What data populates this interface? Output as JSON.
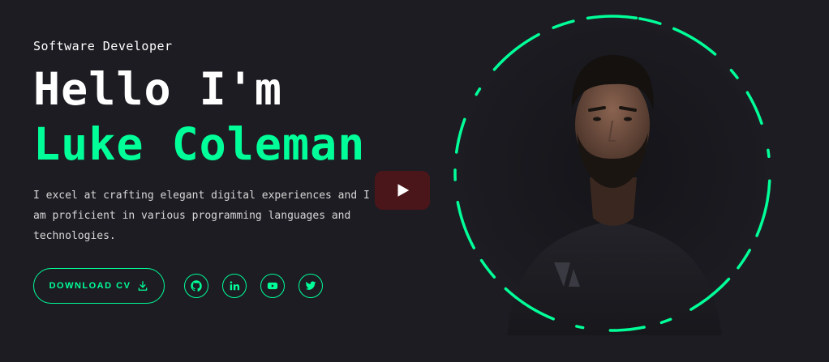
{
  "hero": {
    "role": "Software Developer",
    "title_line1": "Hello I'm",
    "title_line2": "Luke Coleman",
    "description": "I excel at crafting elegant digital experiences and I am proficient in various programming languages and technologies.",
    "download_label": "DOWNLOAD CV"
  },
  "icons": {
    "download": "download-icon",
    "socials": [
      "github-icon",
      "linkedin-icon",
      "youtube-icon",
      "twitter-icon"
    ],
    "play": "play-icon"
  },
  "colors": {
    "background": "#1c1c22",
    "accent": "#00ff99",
    "text": "#ffffff",
    "play_button": "#521618"
  }
}
